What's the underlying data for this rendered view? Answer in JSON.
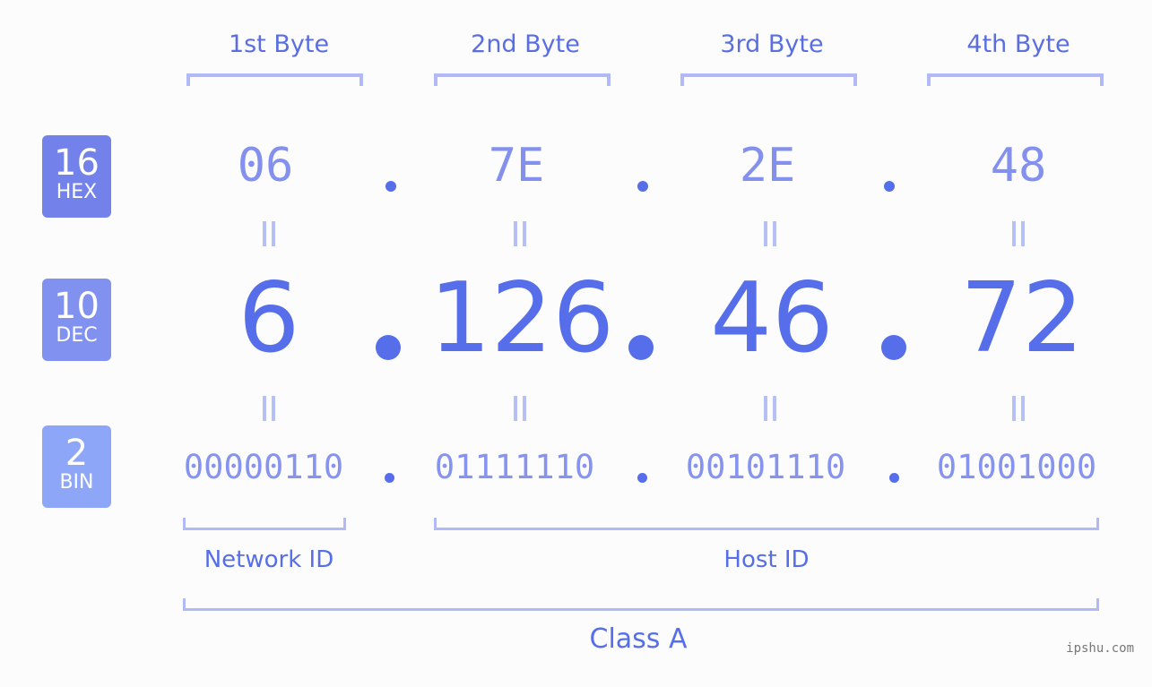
{
  "bytes": {
    "labels": [
      "1st Byte",
      "2nd Byte",
      "3rd Byte",
      "4th Byte"
    ]
  },
  "rows": {
    "hex": {
      "base": "16",
      "name": "HEX",
      "values": [
        "06",
        "7E",
        "2E",
        "48"
      ]
    },
    "dec": {
      "base": "10",
      "name": "DEC",
      "values": [
        "6",
        "126",
        "46",
        "72"
      ]
    },
    "bin": {
      "base": "2",
      "name": "BIN",
      "values": [
        "00000110",
        "01111110",
        "00101110",
        "01001000"
      ]
    }
  },
  "ids": {
    "network": "Network ID",
    "host": "Host ID",
    "class": "Class A"
  },
  "colors": {
    "hex_badge": "#7282ea",
    "dec_badge": "#8191ef",
    "bin_badge": "#8ea6f8",
    "accent": "#566ee9",
    "bracket": "#b1baf6"
  },
  "watermark": "ipshu.com"
}
